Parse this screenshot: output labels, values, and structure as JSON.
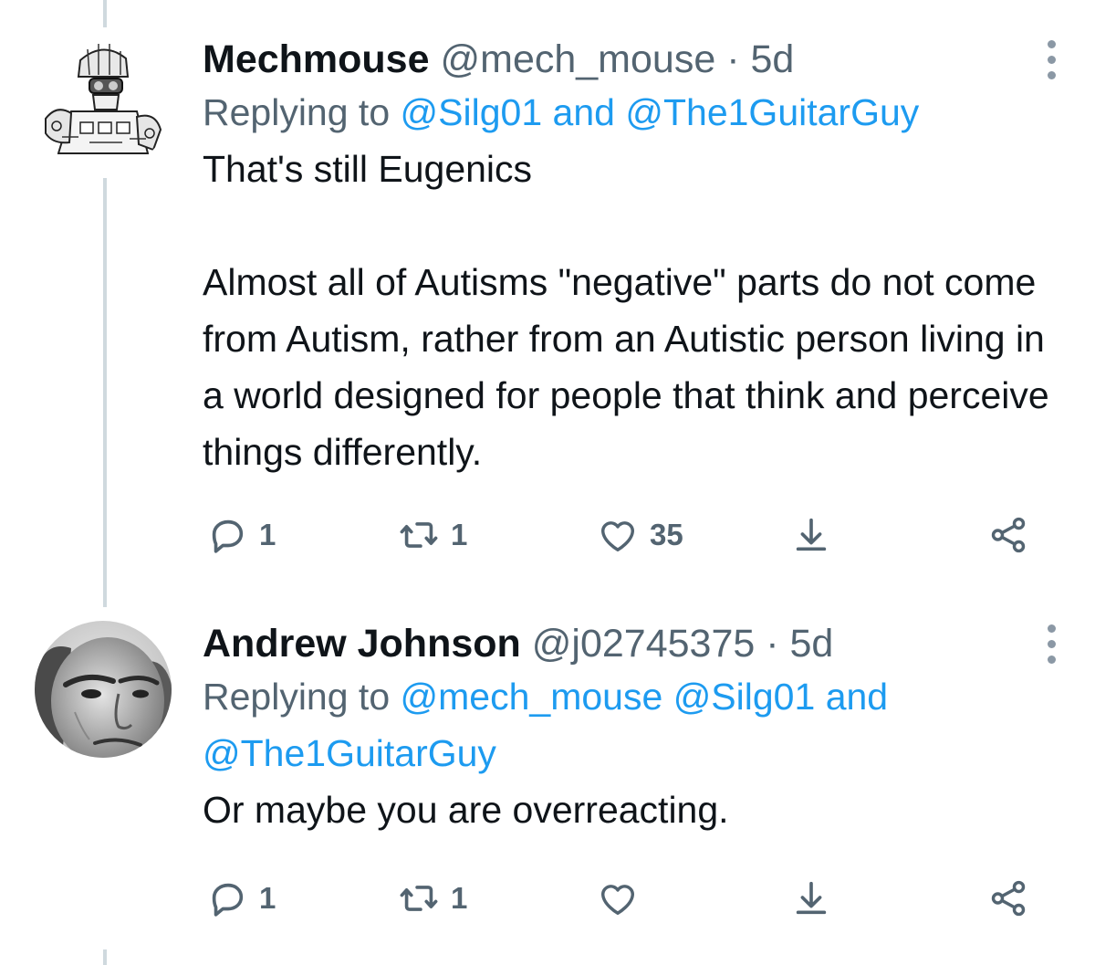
{
  "tweets": [
    {
      "name": "Mechmouse",
      "handle": "@mech_mouse",
      "separator": "·",
      "time": "5d",
      "replying_prefix": "Replying to",
      "mention_1": "@Silg01",
      "and_word": "and",
      "mention_2": "@The1GuitarGuy",
      "text": "That's still Eugenics\n\nAlmost all of Autisms \"negative\" parts do not come from Autism, rather from an Autistic person living in a world designed for people that think and perceive things differently.",
      "replies": "1",
      "retweets": "1",
      "likes": "35"
    },
    {
      "name": "Andrew Johnson",
      "handle": "@j02745375",
      "separator": "·",
      "time": "5d",
      "replying_prefix": "Replying to",
      "mention_1": "@mech_mouse",
      "mention_2": "@Silg01",
      "and_word": "and",
      "mention_3": "@The1GuitarGuy",
      "text": "Or maybe you are overreacting.",
      "replies": "1",
      "retweets": "1",
      "likes": ""
    }
  ],
  "icons": {
    "reply": "reply-icon",
    "retweet": "retweet-icon",
    "like": "heart-icon",
    "share": "share-icon",
    "download": "download-icon",
    "more": "more-vertical-icon"
  },
  "colors": {
    "link": "#1d9bf0",
    "secondary_text": "#536471",
    "primary_text": "#0f1419",
    "thread_line": "#cfd9de"
  }
}
